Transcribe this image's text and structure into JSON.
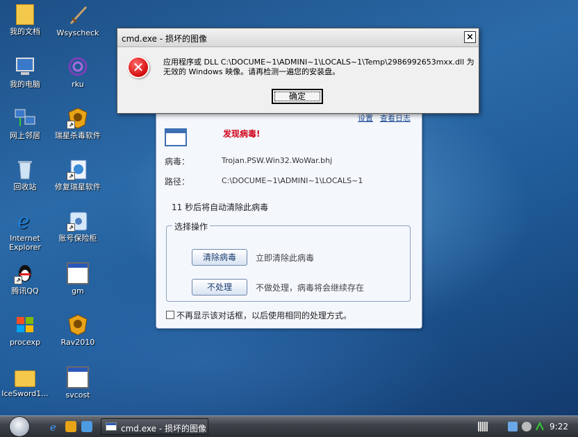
{
  "desktop": {
    "icons": [
      {
        "label": "我的文档",
        "icon": "documents-folder-icon"
      },
      {
        "label": "Wsyscheck",
        "icon": "sword-icon"
      },
      {
        "label": "我的电脑",
        "icon": "computer-icon"
      },
      {
        "label": "rku",
        "icon": "rootkit-unhooker-icon"
      },
      {
        "label": "网上邻居",
        "icon": "network-icon"
      },
      {
        "label": "瑞星杀毒软件",
        "icon": "rising-antivirus-icon"
      },
      {
        "label": "回收站",
        "icon": "recycle-bin-icon"
      },
      {
        "label": "修复瑞星软件",
        "icon": "repair-icon"
      },
      {
        "label": "Internet Explorer",
        "icon": "ie-icon"
      },
      {
        "label": "账号保险柜",
        "icon": "account-safe-icon"
      },
      {
        "label": "腾讯QQ",
        "icon": "qq-penguin-icon"
      },
      {
        "label": "gm",
        "icon": "window-icon"
      },
      {
        "label": "procexp",
        "icon": "windows-flag-icon"
      },
      {
        "label": "Rav2010",
        "icon": "rising-lion-icon"
      },
      {
        "label": "IceSword1...",
        "icon": "folder-icon"
      },
      {
        "label": "svcost",
        "icon": "window-icon"
      }
    ]
  },
  "antivirus": {
    "links": {
      "settings": "设置",
      "view_log": "查看日志"
    },
    "alert": "发现病毒!",
    "virus_label": "病毒：",
    "virus_name": "Trojan.PSW.Win32.WoWar.bhj",
    "path_label": "路径：",
    "path_value": "C:\\DOCUME~1\\ADMINI~1\\LOCALS~1",
    "countdown": "11 秒后将自动清除此病毒",
    "group_title": "选择操作",
    "actions": [
      {
        "button": "清除病毒",
        "desc": "立即清除此病毒"
      },
      {
        "button": "不处理",
        "desc": "不做处理，病毒将会继续存在"
      }
    ],
    "dont_show": "不再显示该对话框，以后使用相同的处理方式。"
  },
  "dialog": {
    "title": "cmd.exe - 损坏的图像",
    "close": "×",
    "message": "应用程序或 DLL C:\\DOCUME~1\\ADMINI~1\\LOCALS~1\\Temp\\2986992653mxx.dll 为无效的 Windows 映像。请再检测一遍您的安装盘。",
    "ok": "确定"
  },
  "taskbar": {
    "task_label": "cmd.exe - 损坏的图像",
    "clock": "9:22"
  },
  "colors": {
    "alert_red": "#d0021b",
    "taskbar": "#2b2e34",
    "desktop_blue": "#2b6aa8"
  }
}
